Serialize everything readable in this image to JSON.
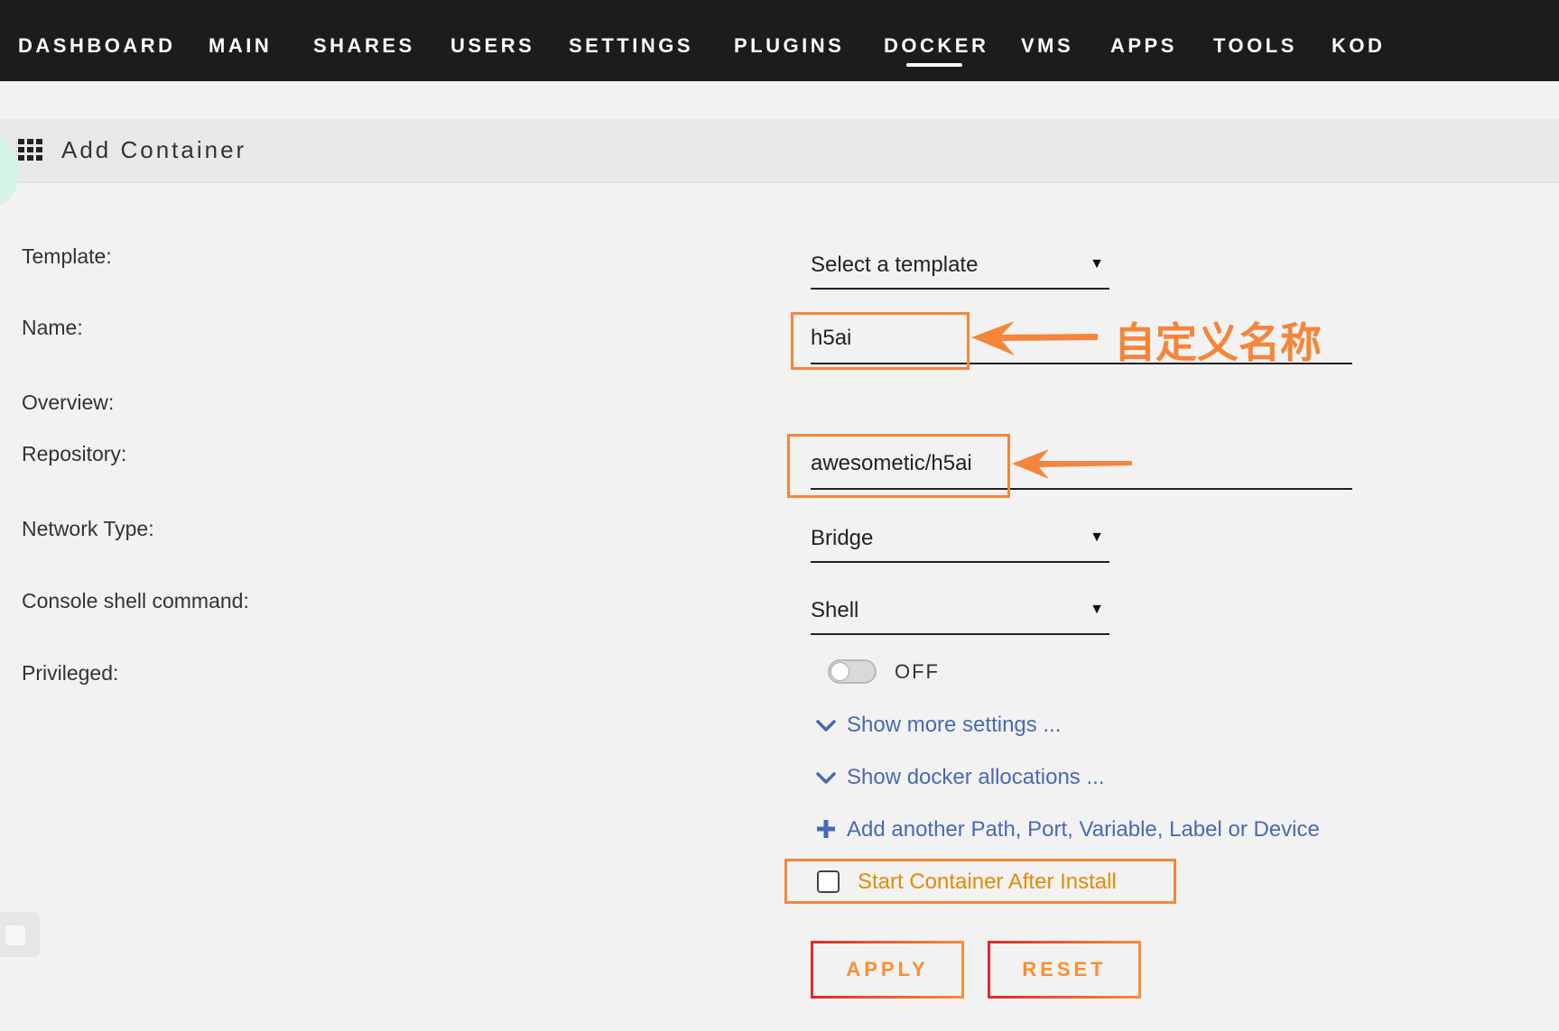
{
  "nav": {
    "items": [
      {
        "label": "DASHBOARD"
      },
      {
        "label": "MAIN"
      },
      {
        "label": "SHARES"
      },
      {
        "label": "USERS"
      },
      {
        "label": "SETTINGS"
      },
      {
        "label": "PLUGINS"
      },
      {
        "label": "DOCKER"
      },
      {
        "label": "VMS"
      },
      {
        "label": "APPS"
      },
      {
        "label": "TOOLS"
      },
      {
        "label": "KOD"
      }
    ],
    "active_item": "DOCKER"
  },
  "header": {
    "title": "Add Container",
    "icon": "grid-icon"
  },
  "form": {
    "template": {
      "label": "Template:",
      "value": "Select a template"
    },
    "name": {
      "label": "Name:",
      "value": "h5ai"
    },
    "overview": {
      "label": "Overview:"
    },
    "repository": {
      "label": "Repository:",
      "value": "awesometic/h5ai"
    },
    "network_type": {
      "label": "Network Type:",
      "value": "Bridge"
    },
    "console_shell": {
      "label": "Console shell command:",
      "value": "Shell"
    },
    "privileged": {
      "label": "Privileged:",
      "state": "OFF",
      "enabled": false
    }
  },
  "links": {
    "show_more_settings": "Show more settings ...",
    "show_docker_allocations": "Show docker allocations ...",
    "add_another": "Add another Path, Port, Variable, Label or Device"
  },
  "start_after_install": {
    "label": "Start Container After Install",
    "checked": false
  },
  "buttons": {
    "apply": "APPLY",
    "reset": "RESET"
  },
  "annotation": {
    "name_note": "自定义名称"
  },
  "icons": {
    "select_arrow": "▼",
    "expand": "chevron-down-icon",
    "add": "plus-icon"
  },
  "colors": {
    "nav_background": "#1c1c1c",
    "page_background": "#f2f2f2",
    "link": "#486ab4",
    "annotation": "#f5853a",
    "checkbox_label": "#e68a00",
    "button_text": "#ff8c2f"
  }
}
